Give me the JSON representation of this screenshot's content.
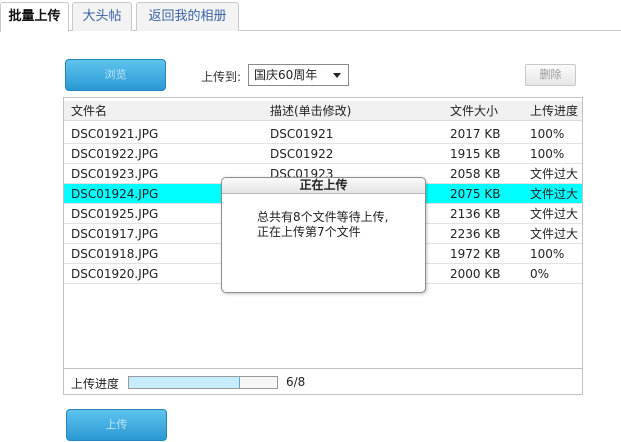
{
  "tabs": [
    {
      "label": "批量上传",
      "active": true
    },
    {
      "label": "大头帖",
      "active": false
    },
    {
      "label": "返回我的相册",
      "active": false
    }
  ],
  "toolbar": {
    "browse_label": "浏览",
    "upload_to_label": "上传到:",
    "album_selected": "国庆60周年",
    "delete_label": "删除"
  },
  "table": {
    "headers": {
      "name": "文件名",
      "desc": "描述(单击修改)",
      "size": "文件大小",
      "progress": "上传进度"
    },
    "rows": [
      {
        "name": "DSC01921.JPG",
        "desc": "DSC01921",
        "size": "2017 KB",
        "progress": "100%",
        "highlight": false
      },
      {
        "name": "DSC01922.JPG",
        "desc": "DSC01922",
        "size": "1915 KB",
        "progress": "100%",
        "highlight": false
      },
      {
        "name": "DSC01923.JPG",
        "desc": "DSC01923",
        "size": "2058 KB",
        "progress": "文件过大",
        "highlight": false
      },
      {
        "name": "DSC01924.JPG",
        "desc": "",
        "size": "2075 KB",
        "progress": "文件过大",
        "highlight": true
      },
      {
        "name": "DSC01925.JPG",
        "desc": "",
        "size": "2136 KB",
        "progress": "文件过大",
        "highlight": false
      },
      {
        "name": "DSC01917.JPG",
        "desc": "",
        "size": "2236 KB",
        "progress": "文件过大",
        "highlight": false
      },
      {
        "name": "DSC01918.JPG",
        "desc": "",
        "size": "1972 KB",
        "progress": "100%",
        "highlight": false
      },
      {
        "name": "DSC01920.JPG",
        "desc": "",
        "size": "2000 KB",
        "progress": "0%",
        "highlight": false
      }
    ]
  },
  "progress": {
    "label": "上传进度",
    "count": "6/8",
    "fraction": 0.75
  },
  "dialog": {
    "title": "正在上传",
    "line1": "总共有8个文件等待上传,",
    "line2": "正在上传第7个文件"
  },
  "footer": {
    "upload_label": "上传"
  },
  "colors": {
    "highlight_row": "#00ffff",
    "button_blue": "#2b98d4",
    "progress_fill": "#c7ecff"
  }
}
